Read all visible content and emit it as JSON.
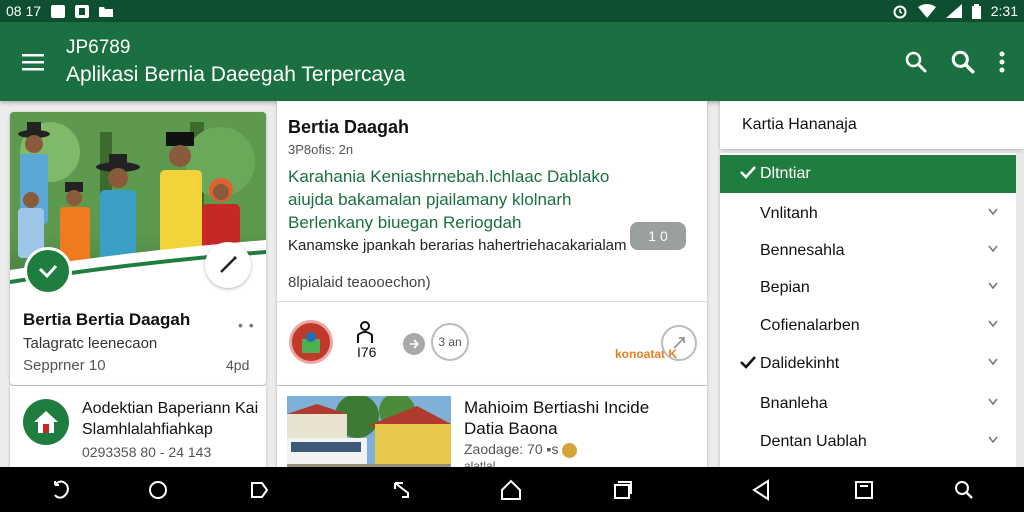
{
  "status_bar": {
    "left_text": "08 17",
    "time": "2:31",
    "icons": [
      "notification-icon",
      "image-icon",
      "photo-icon",
      "folder-icon",
      "alarm-icon",
      "wifi-icon",
      "signal-icon",
      "battery-icon"
    ]
  },
  "app_bar": {
    "code": "JP6789",
    "title": "Aplikasi Bernia Daeegah Terpercaya",
    "icons": [
      "menu-icon",
      "search-icon",
      "search-icon",
      "more-vert-icon"
    ]
  },
  "feature_card": {
    "title": "Bertia Bertia Daagah",
    "subtitle": "Talagratc leenecaon",
    "date": "Sepprner 10",
    "time": "4pd",
    "more": "• •"
  },
  "small_card": {
    "line1": "Aodektian Baperiann Kai",
    "line2": "Slamhlalahfiahkap",
    "meta": "0293358 80 - 24 143"
  },
  "article_card": {
    "title": "Bertia Daagah",
    "meta": "3P8ofis: 2n",
    "highlight": "Karahania Keniashrnebah.lchlaac Dablako aiujda bakamalan pjailamany klolnarh Berlenkany biuegan Reriogdah",
    "description": "Kanamske jpankah berarias hahertriehacakarialam",
    "pill_label": "1 0",
    "small_text": "8lpialaid teaooechon)",
    "person_label": "I76",
    "circle_button_label": "3 an",
    "brand": "konoatat K"
  },
  "news_card": {
    "line1": "Mahioim Bertiashi Incide",
    "line2": "Datia Baona",
    "meta": "Zaodage: 70 ▪s",
    "extra": "alatlal"
  },
  "filter": {
    "header": "Kartia Hananaja",
    "items": [
      {
        "label": "Dltntiar",
        "checked": true,
        "active": true
      },
      {
        "label": "Vnlitanh",
        "checked": false,
        "active": false
      },
      {
        "label": "Bennesahla",
        "checked": false,
        "active": false
      },
      {
        "label": "Bepian",
        "checked": false,
        "active": false
      },
      {
        "label": "Cofienalarben",
        "checked": false,
        "active": false
      },
      {
        "label": "Dalidekinht",
        "checked": true,
        "active": false
      },
      {
        "label": "Bnanleha",
        "checked": false,
        "active": false
      },
      {
        "label": "Dentan Uablah",
        "checked": false,
        "active": false
      }
    ]
  },
  "nav_bar": {
    "buttons": [
      "back-icon",
      "home-icon",
      "recents-icon",
      "back-icon",
      "home-icon",
      "recents-icon",
      "back-icon",
      "recents-icon",
      "search-icon"
    ]
  },
  "colors": {
    "primary": "#1a7040",
    "primary_dark": "#0d4f2e",
    "accent": "#1f7d3f",
    "brand_orange": "#e67e22"
  }
}
